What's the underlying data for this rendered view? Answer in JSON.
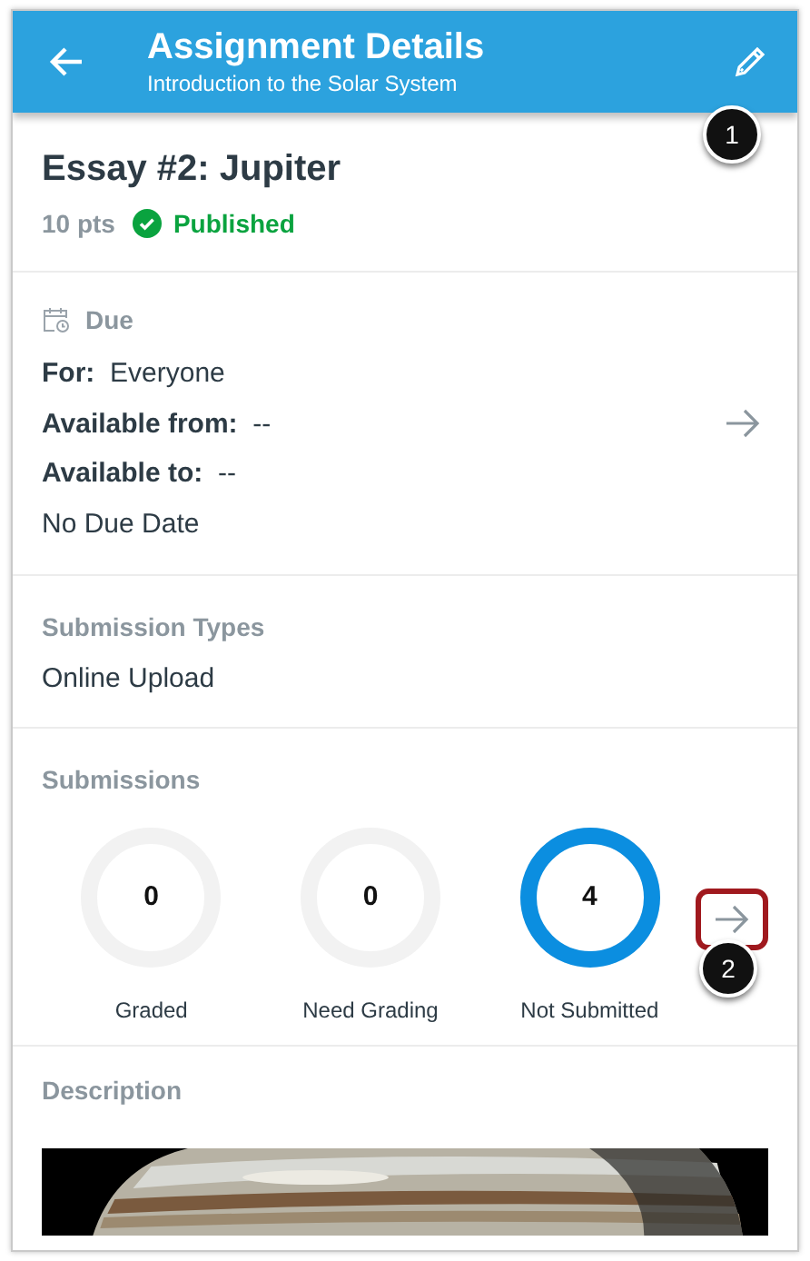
{
  "header": {
    "title": "Assignment Details",
    "subtitle": "Introduction to the Solar System"
  },
  "assignment": {
    "title": "Essay #2: Jupiter",
    "points": "10 pts",
    "status": "Published",
    "published": true
  },
  "due": {
    "heading": "Due",
    "rows": [
      "**For:**  Everyone",
      "**Available from:**  --",
      "**Available to:**  --"
    ],
    "note": "No Due Date"
  },
  "submission_types": {
    "heading": "Submission Types",
    "value": "Online Upload"
  },
  "submissions": {
    "heading": "Submissions",
    "stats": [
      {
        "count": "0",
        "label": "Graded",
        "level": 0
      },
      {
        "count": "0",
        "label": "Need Grading",
        "level": 0
      },
      {
        "count": "4",
        "label": "Not Submitted",
        "level": 1
      }
    ]
  },
  "description": {
    "heading": "Description"
  },
  "callouts": [
    {
      "number": "1"
    },
    {
      "number": "2"
    }
  ]
}
